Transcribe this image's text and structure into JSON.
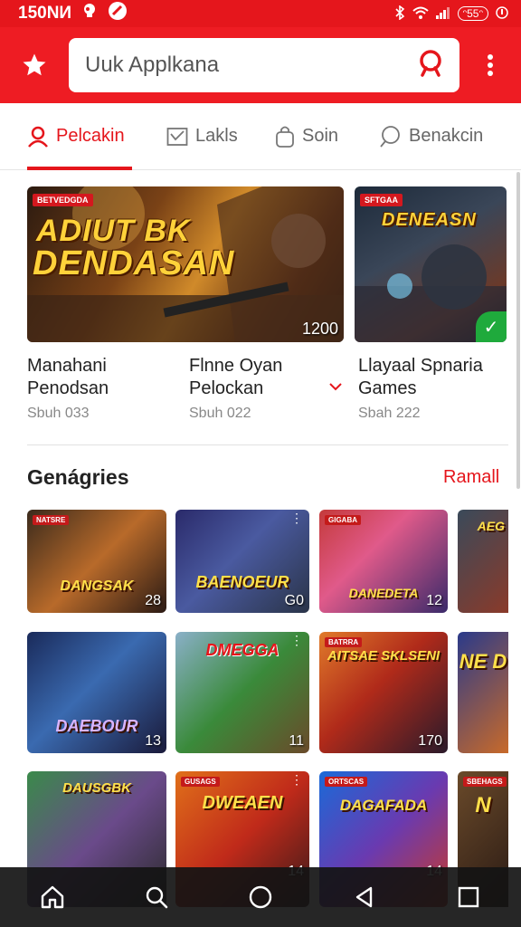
{
  "status_bar": {
    "time": "150NИ",
    "right_text": "ᵔ55ᵔ"
  },
  "header": {
    "search_placeholder": "Uuk Applkana"
  },
  "tabs": [
    {
      "label": "Pelcakin",
      "icon": "person-icon",
      "active": true
    },
    {
      "label": "Lakls",
      "icon": "inbox-icon",
      "active": false
    },
    {
      "label": "Soin",
      "icon": "bag-icon",
      "active": false
    },
    {
      "label": "Benakcin",
      "icon": "chat-icon",
      "active": false
    }
  ],
  "featured": [
    {
      "tag": "BETVEDGDA",
      "logo_line1": "ADIUT BK",
      "logo_line2": "DENDASAN",
      "count": "1200",
      "title_line1": "Manahani",
      "title_line2": "Penodsan",
      "subtitle": "Sbuh 033"
    },
    {
      "title_line1": "Flnne Oyan",
      "title_line2": "Pelockan",
      "subtitle": "Sbuh 022"
    },
    {
      "tag": "SFTGAA",
      "logo_line1": "DENEASN",
      "title_line1": "Llayaal Spnaria",
      "title_line2": "Games",
      "subtitle": "Sbah 222"
    }
  ],
  "section": {
    "title": "Genágries",
    "link": "Ramall"
  },
  "tiles": [
    {
      "tag": "NATSRE",
      "logo": "DANGSAK",
      "count": "28"
    },
    {
      "tag": "",
      "logo": "BAENOEUR",
      "count": "G0"
    },
    {
      "tag": "GIGABA",
      "logo": "DANEDETA",
      "count": "12"
    },
    {
      "tag": "",
      "logo": "AEG",
      "count": ""
    },
    {
      "tag": "",
      "logo": "DAEBOUR",
      "count": "13"
    },
    {
      "tag": "",
      "logo": "DMEGGA",
      "count": "11"
    },
    {
      "tag": "BATRRA",
      "logo": "AITSAE SKLSENI",
      "count": "170"
    },
    {
      "tag": "",
      "logo": "NE D",
      "count": ""
    },
    {
      "tag": "",
      "logo": "DAUSGBK",
      "count": ""
    },
    {
      "tag": "GUSAGS",
      "logo": "DWEAEN",
      "count": "14"
    },
    {
      "tag": "ORTSCAS",
      "logo": "DAGAFADA",
      "count": "14"
    },
    {
      "tag": "SBEHAGS",
      "logo": "N",
      "count": ""
    }
  ]
}
